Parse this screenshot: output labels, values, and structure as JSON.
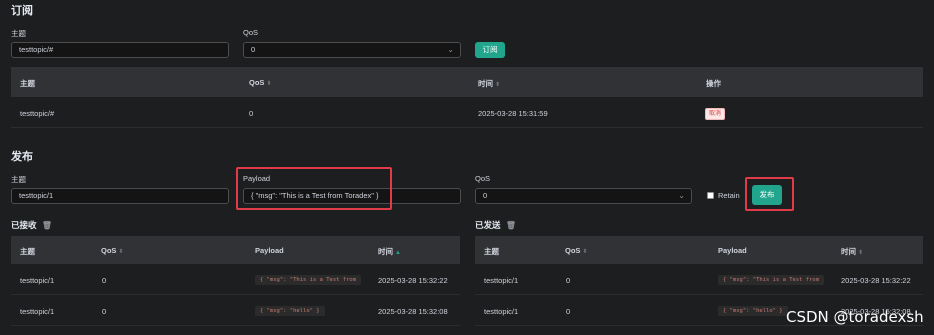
{
  "subscribe": {
    "title": "订阅",
    "topic_label": "主题",
    "topic_value": "testtopic/#",
    "qos_label": "QoS",
    "qos_value": "0",
    "button_label": "订阅",
    "table_headers": [
      "主题",
      "QoS",
      "时间",
      "操作"
    ],
    "rows": [
      {
        "topic": "testtopic/#",
        "qos": "0",
        "time": "2025-03-28 15:31:59",
        "action": "取消"
      }
    ]
  },
  "publish": {
    "title": "发布",
    "topic_label": "主题",
    "topic_value": "testtopic/1",
    "payload_label": "Payload",
    "payload_value": "{ \"msg\": \"This is a Test from Toradex\" }",
    "qos_label": "QoS",
    "qos_value": "0",
    "retain_label": "Retain",
    "button_label": "发布"
  },
  "received": {
    "title": "已接收",
    "headers": [
      "主题",
      "QoS",
      "Payload",
      "时间"
    ],
    "rows": [
      {
        "topic": "testtopic/1",
        "qos": "0",
        "payload": "{ \"msg\": \"This is a Test from",
        "time": "2025-03-28 15:32:22"
      },
      {
        "topic": "testtopic/1",
        "qos": "0",
        "payload": "{ \"msg\": \"hello\" }",
        "time": "2025-03-28 15:32:08"
      }
    ]
  },
  "sent": {
    "title": "已发送",
    "headers": [
      "主题",
      "QoS",
      "Payload",
      "时间"
    ],
    "rows": [
      {
        "topic": "testtopic/1",
        "qos": "0",
        "payload": "{ \"msg\": \"This is a Test from",
        "time": "2025-03-28 15:32:22"
      },
      {
        "topic": "testtopic/1",
        "qos": "0",
        "payload": "{ \"msg\": \"hello\" }",
        "time": "2025-03-28 15:32:08"
      }
    ]
  },
  "watermark": "CSDN @toradexsh",
  "colors": {
    "accent": "#21a58c",
    "highlight_box": "#e03b48",
    "background": "#1d1e1f"
  }
}
